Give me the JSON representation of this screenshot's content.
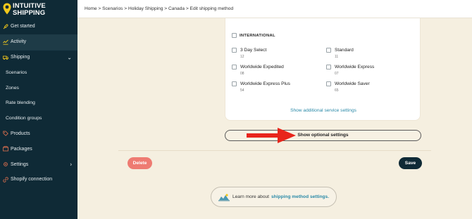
{
  "app": {
    "logo_line1": "INTUITIVE",
    "logo_line2": "SHIPPING"
  },
  "sidebar": {
    "items": [
      {
        "label": "Get started",
        "icon": "rocket-icon"
      },
      {
        "label": "Activity",
        "icon": "activity-icon"
      },
      {
        "label": "Shipping",
        "icon": "truck-icon"
      },
      {
        "label": "Scenarios"
      },
      {
        "label": "Zones"
      },
      {
        "label": "Rate blending"
      },
      {
        "label": "Condition groups"
      },
      {
        "label": "Products",
        "icon": "tag-icon"
      },
      {
        "label": "Packages",
        "icon": "package-icon"
      },
      {
        "label": "Settings",
        "icon": "gear-icon"
      },
      {
        "label": "Shopify connection",
        "icon": "link-icon"
      }
    ]
  },
  "breadcrumb": {
    "text": "Home > Scenarios > Holiday Shipping > Canada > Edit shipping method"
  },
  "services": {
    "section_title": "INTERNATIONAL",
    "items": [
      {
        "name": "3 Day Select",
        "code": "12"
      },
      {
        "name": "Standard",
        "code": "11"
      },
      {
        "name": "Worldwide Expedited",
        "code": "08"
      },
      {
        "name": "Worldwide Express",
        "code": "07"
      },
      {
        "name": "Worldwide Express Plus",
        "code": "54"
      },
      {
        "name": "Worldwide Saver",
        "code": "65"
      }
    ],
    "additional_link": "Show additional service settings"
  },
  "optional_settings_label": "Show optional settings",
  "actions": {
    "delete_label": "Delete",
    "save_label": "Save"
  },
  "learn_more": {
    "prefix": "Learn more about",
    "link": "shipping method settings."
  },
  "colors": {
    "sidebar_bg": "#0f2a36",
    "page_bg": "#f5efe0",
    "accent_link": "#2b8aa8",
    "delete": "#ee7b72",
    "save": "#0f2a36",
    "arrow": "#e8251b",
    "logo_yellow": "#f2c81b"
  }
}
